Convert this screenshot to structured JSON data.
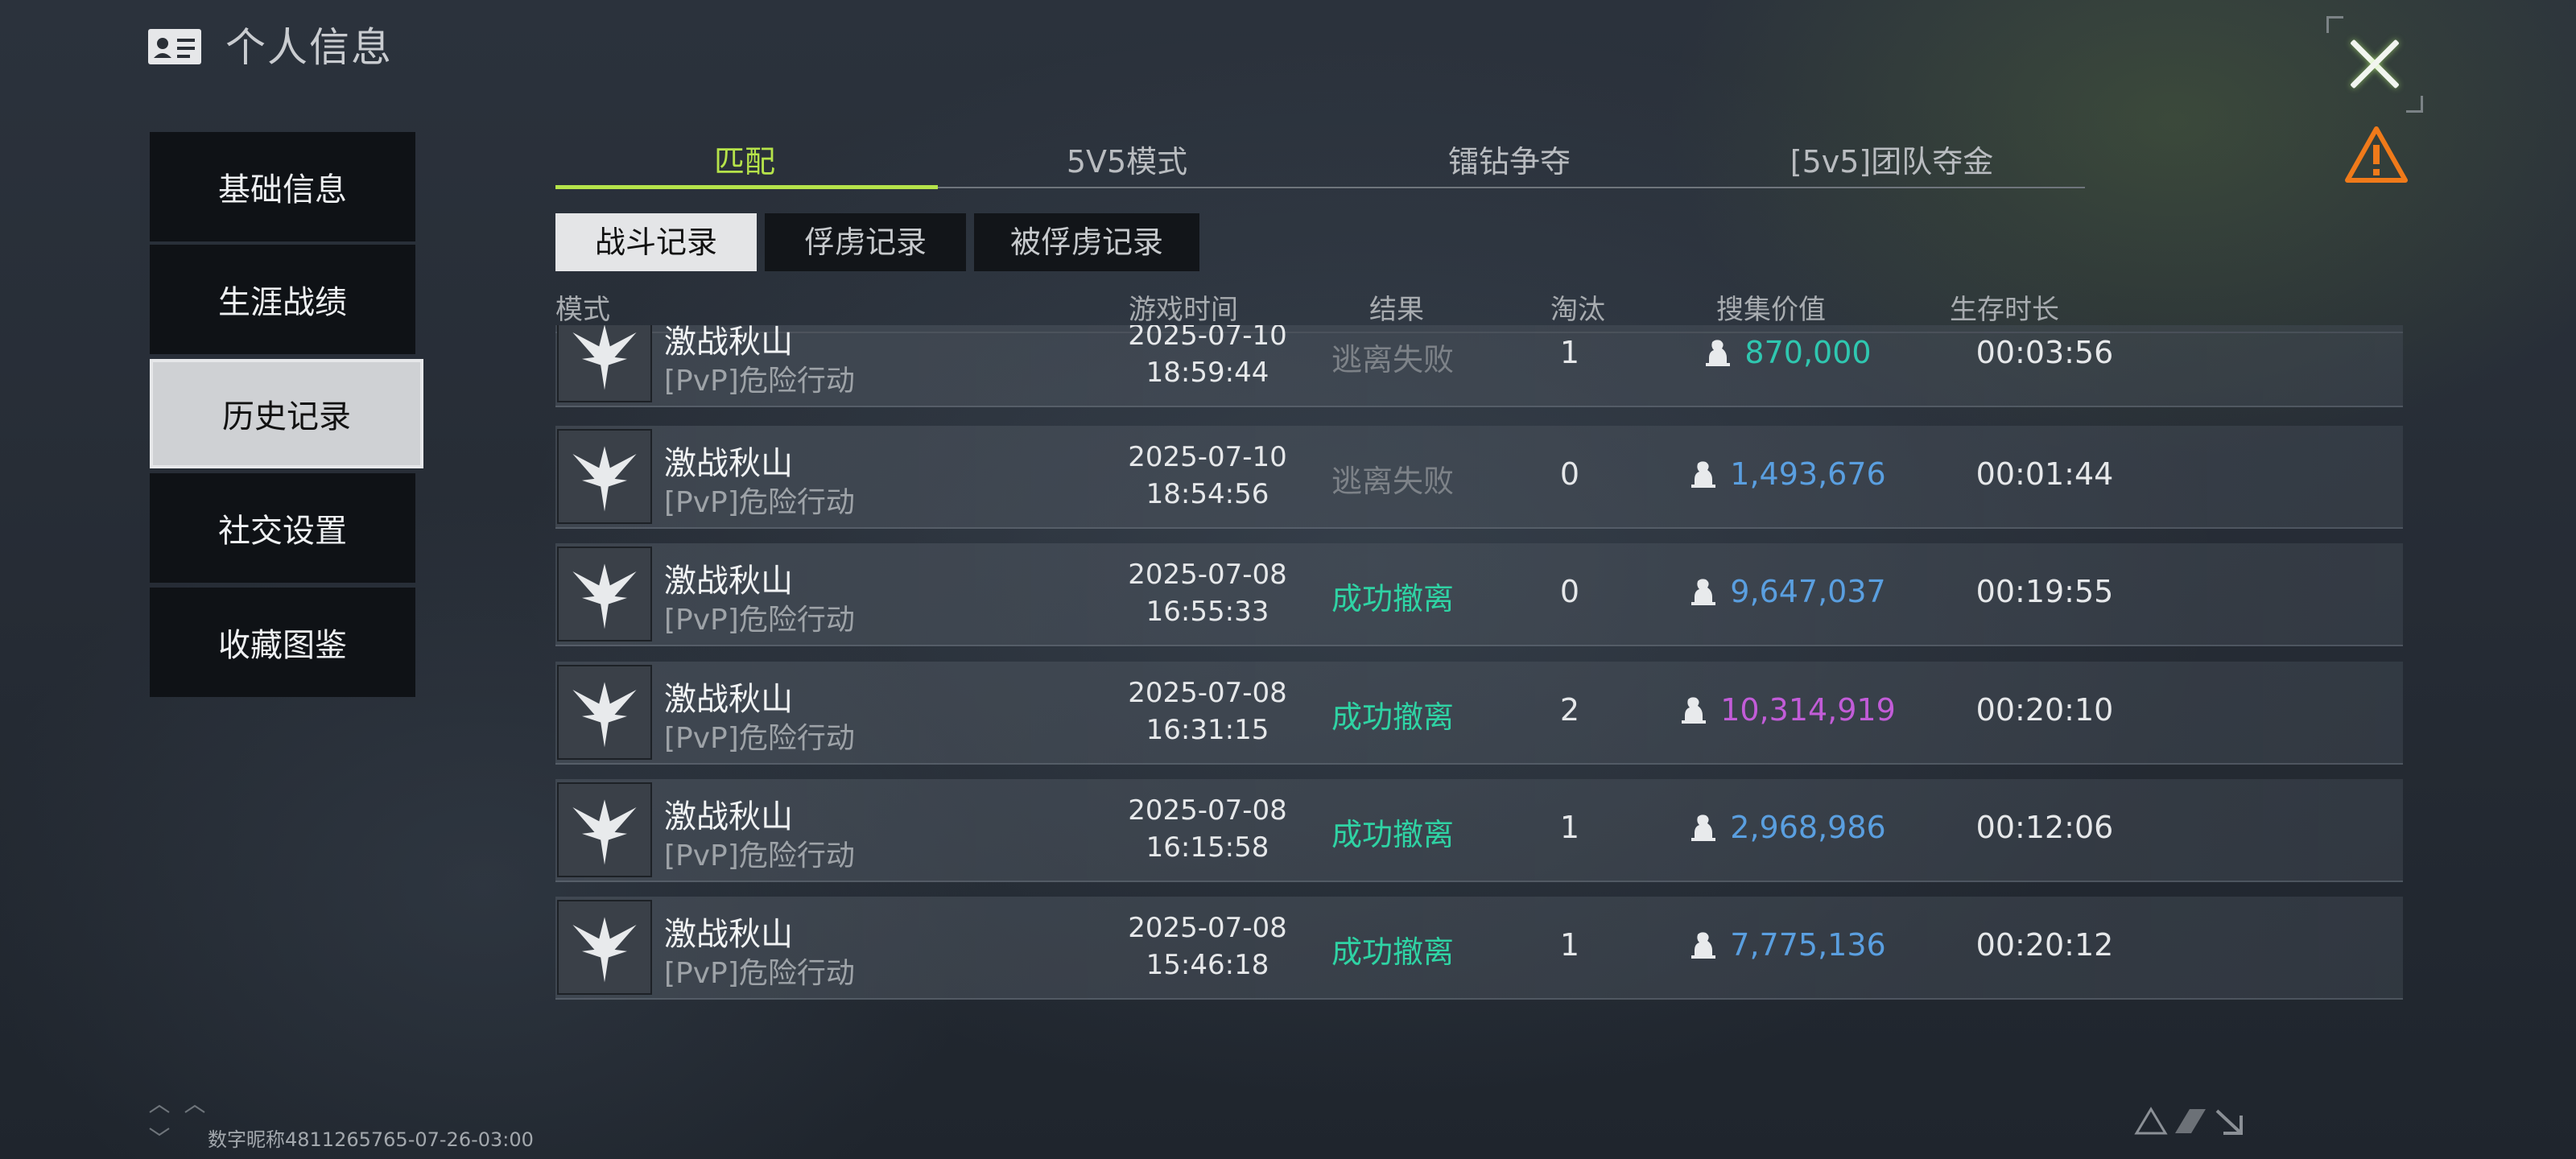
{
  "header": {
    "title": "个人信息",
    "icon": "id-card-icon"
  },
  "close_icon": "close-icon",
  "warning_icon": "warning-icon",
  "sidebar": {
    "items": [
      {
        "label": "基础信息"
      },
      {
        "label": "生涯战绩"
      },
      {
        "label": "历史记录",
        "active": true
      },
      {
        "label": "社交设置"
      },
      {
        "label": "收藏图鉴"
      }
    ]
  },
  "tabs": [
    {
      "label": "匹配",
      "active": true
    },
    {
      "label": "5V5模式"
    },
    {
      "label": "镭钻争夺"
    },
    {
      "label": "[5v5]团队夺金"
    }
  ],
  "subtabs": [
    {
      "label": "战斗记录",
      "active": true
    },
    {
      "label": "俘虏记录"
    },
    {
      "label": "被俘虏记录"
    }
  ],
  "columns": {
    "mode": "模式",
    "time": "游戏时间",
    "result": "结果",
    "kills": "淘汰",
    "value": "搜集价值",
    "survive": "生存时长"
  },
  "rows": [
    {
      "name": "激战秋山",
      "sub": "[PvP]危险行动",
      "date": "2025-07-10",
      "time": "18:59:44",
      "result": "逃离失败",
      "kills": "1",
      "value": "870,000",
      "survive": "00:03:56"
    },
    {
      "name": "激战秋山",
      "sub": "[PvP]危险行动",
      "date": "2025-07-10",
      "time": "18:54:56",
      "result": "逃离失败",
      "kills": "0",
      "value": "1,493,676",
      "survive": "00:01:44"
    },
    {
      "name": "激战秋山",
      "sub": "[PvP]危险行动",
      "date": "2025-07-08",
      "time": "16:55:33",
      "result": "成功撤离",
      "kills": "0",
      "value": "9,647,037",
      "survive": "00:19:55"
    },
    {
      "name": "激战秋山",
      "sub": "[PvP]危险行动",
      "date": "2025-07-08",
      "time": "16:31:15",
      "result": "成功撤离",
      "kills": "2",
      "value": "10,314,919",
      "survive": "00:20:10"
    },
    {
      "name": "激战秋山",
      "sub": "[PvP]危险行动",
      "date": "2025-07-08",
      "time": "16:15:58",
      "result": "成功撤离",
      "kills": "1",
      "value": "2,968,986",
      "survive": "00:12:06"
    },
    {
      "name": "激战秋山",
      "sub": "[PvP]危险行动",
      "date": "2025-07-08",
      "time": "15:46:18",
      "result": "成功撤离",
      "kills": "1",
      "value": "7,775,136",
      "survive": "00:20:12"
    }
  ],
  "colors": {
    "accent": "#b6e34a",
    "success": "#2fd3a4",
    "fail": "#7d8288",
    "value_teal": "#2fc7b0",
    "value_blue": "#5a9fe0",
    "value_purple": "#c25cd8"
  },
  "footer": {
    "nickname_text": "数字昵称4811265765-07-26-03:00"
  }
}
